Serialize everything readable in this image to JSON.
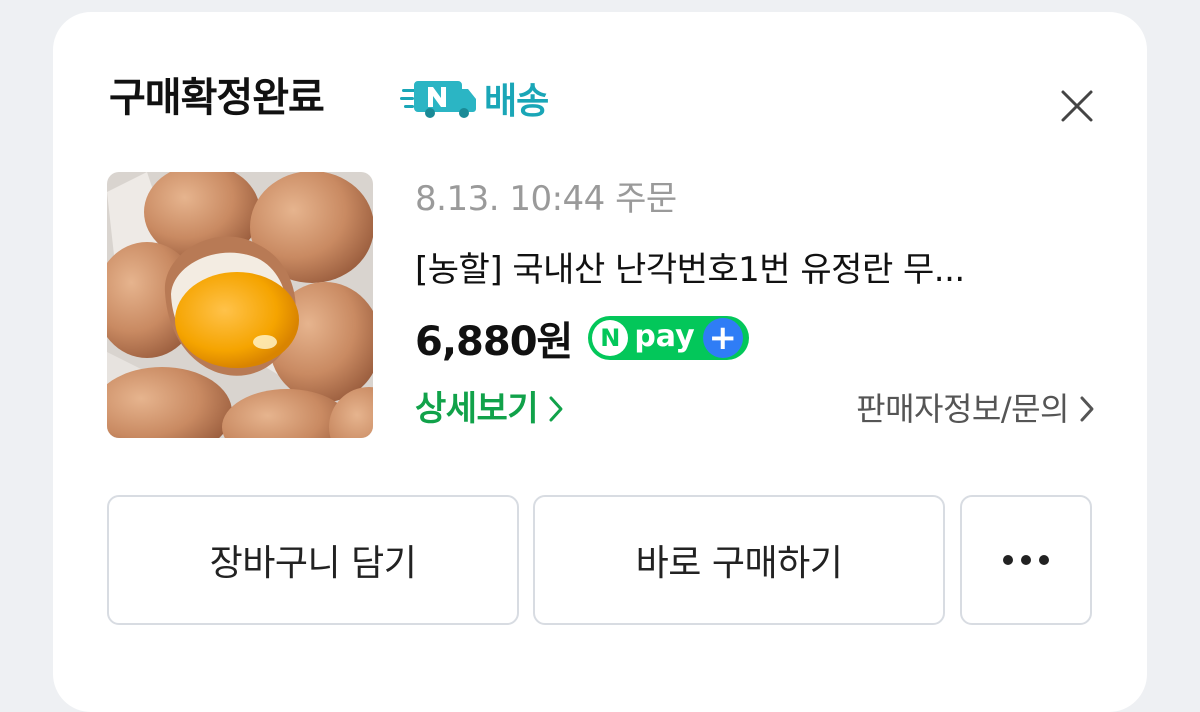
{
  "header": {
    "title": "구매확정완료",
    "badge_text": "배송",
    "badge_icon": "naver-delivery-truck-icon",
    "badge_color": "#1aa6b7"
  },
  "order": {
    "date": "8.13. 10:44 주문",
    "product_name": "[농할] 국내산 난각번호1번 유정란 무...",
    "price": "6,880원",
    "npay_label": "pay",
    "npay_mark": "N",
    "npay_plus": "+",
    "detail_link": "상세보기",
    "seller_link": "판매자정보/문의"
  },
  "actions": {
    "cart_label": "장바구니 담기",
    "buy_label": "바로 구매하기",
    "more_icon": "more-dots-icon"
  },
  "colors": {
    "accent_green": "#11a24a",
    "npay_green": "#03c75a",
    "npay_blue": "#2f7df6"
  }
}
